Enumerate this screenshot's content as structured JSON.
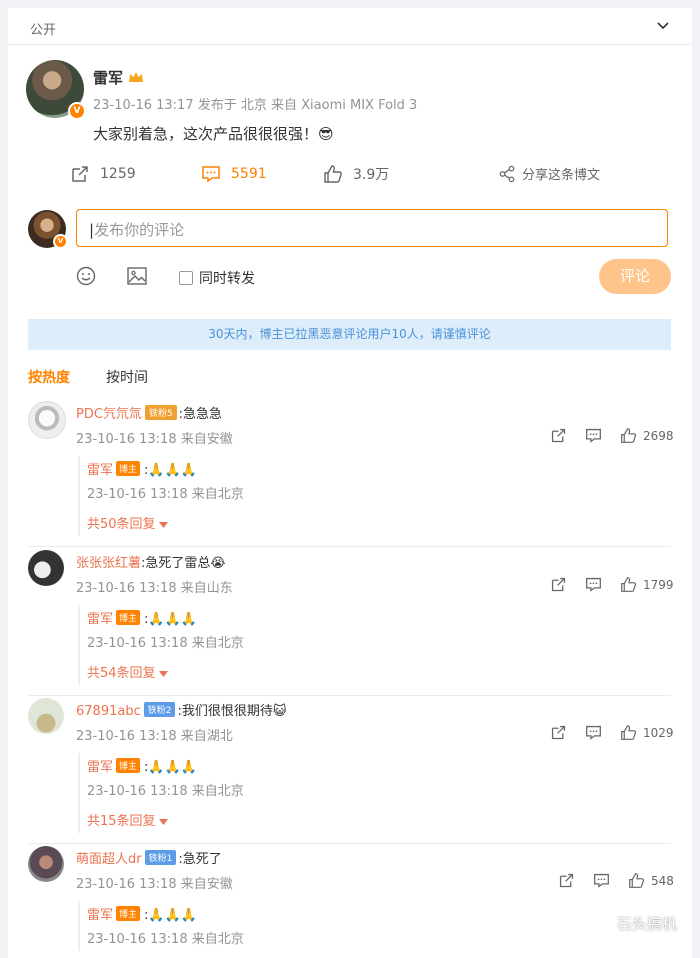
{
  "header": {
    "visibility": "公开"
  },
  "post": {
    "author": "雷军",
    "meta": "23-10-16 13:17 发布于 北京 来自 Xiaomi MIX Fold 3",
    "text": "大家别着急，这次产品很很很强！",
    "emoji": "😎",
    "repost_count": "1259",
    "comment_count": "5591",
    "like_count": "3.9万",
    "share_label": "分享这条博文"
  },
  "composer": {
    "placeholder": "发布你的评论",
    "repost_label": "同时转发",
    "submit_label": "评论"
  },
  "notice": "30天内，博主已拉黑恶意评论用户10人，请谨慎评论",
  "sort": {
    "active": "按热度",
    "other": "按时间"
  },
  "comments": [
    {
      "name": "PDC氕氘氚",
      "fan_tag": "铁粉5",
      "text": ":急急急",
      "meta": "23-10-16 13:18 来自安徽",
      "likes": "2698",
      "reply": {
        "name": "雷军",
        "tag": "博主",
        "text": ":🙏🙏🙏",
        "meta": "23-10-16 13:18 来自北京"
      },
      "more": "共50条回复"
    },
    {
      "name": "张张张红薯",
      "fan_tag": "",
      "text": ":急死了雷总😭",
      "meta": "23-10-16 13:18 来自山东",
      "likes": "1799",
      "reply": {
        "name": "雷军",
        "tag": "博主",
        "text": ":🙏🙏🙏",
        "meta": "23-10-16 13:18 来自北京"
      },
      "more": "共54条回复"
    },
    {
      "name": "67891abc",
      "fan_tag": "铁粉2",
      "text": ":我们很恨很期待😺",
      "meta": "23-10-16 13:18 来自湖北",
      "likes": "1029",
      "reply": {
        "name": "雷军",
        "tag": "博主",
        "text": ":🙏🙏🙏",
        "meta": "23-10-16 13:18 来自北京"
      },
      "more": "共15条回复"
    },
    {
      "name": "萌面超人dr",
      "fan_tag": "铁粉1",
      "text": ":急死了",
      "meta": "23-10-16 13:18 来自安徽",
      "likes": "548",
      "reply": {
        "name": "雷军",
        "tag": "博主",
        "text": ":🙏🙏🙏",
        "meta": "23-10-16 13:18 来自北京"
      },
      "more": ""
    }
  ],
  "watermark": "石头搞机",
  "colors": {
    "accent": "#ff8200",
    "link": "#eb7350",
    "notice_bg": "#ddeefa"
  }
}
